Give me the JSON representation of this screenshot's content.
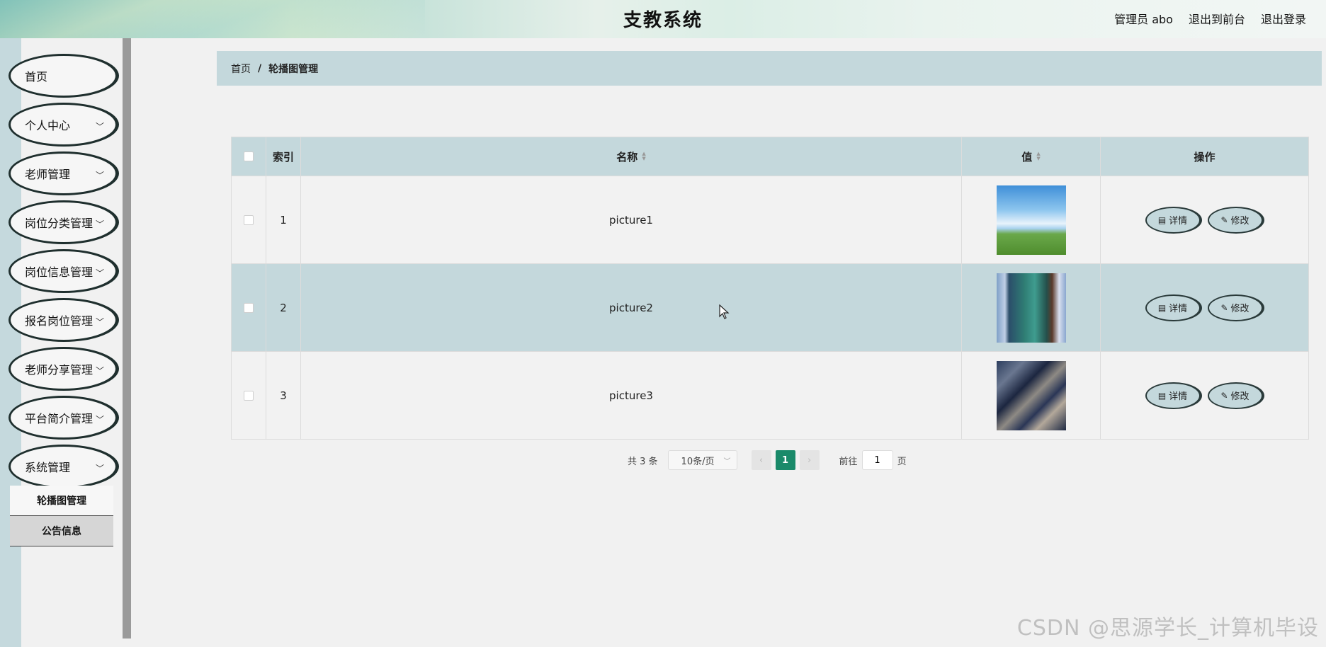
{
  "header": {
    "title": "支教系统",
    "user": "管理员 abo",
    "to_front": "退出到前台",
    "logout": "退出登录"
  },
  "sidebar": {
    "items": [
      {
        "label": "首页",
        "has_chevron": false
      },
      {
        "label": "个人中心",
        "has_chevron": true
      },
      {
        "label": "老师管理",
        "has_chevron": true
      },
      {
        "label": "岗位分类管理",
        "has_chevron": true
      },
      {
        "label": "岗位信息管理",
        "has_chevron": true
      },
      {
        "label": "报名岗位管理",
        "has_chevron": true
      },
      {
        "label": "老师分享管理",
        "has_chevron": true
      },
      {
        "label": "平台简介管理",
        "has_chevron": true
      },
      {
        "label": "系统管理",
        "has_chevron": true
      }
    ],
    "sub_items": [
      {
        "label": "轮播图管理",
        "active": true
      },
      {
        "label": "公告信息",
        "active": false
      }
    ]
  },
  "breadcrumb": {
    "home": "首页",
    "separator": "/",
    "current": "轮播图管理"
  },
  "table": {
    "headers": {
      "index": "索引",
      "name": "名称",
      "value": "值",
      "actions": "操作"
    },
    "rows": [
      {
        "index": "1",
        "name": "picture1",
        "thumb": "sky-grass-image"
      },
      {
        "index": "2",
        "name": "picture2",
        "thumb": "classroom-image"
      },
      {
        "index": "3",
        "name": "picture3",
        "thumb": "desks-image"
      }
    ],
    "detail_label": "详情",
    "edit_label": "修改"
  },
  "pagination": {
    "total": "共 3 条",
    "page_size": "10条/页",
    "current_page": "1",
    "goto_prefix": "前往",
    "goto_value": "1",
    "goto_suffix": "页"
  },
  "watermark": "CSDN @思源学长_计算机毕设",
  "colors": {
    "accent_teal": "#c4d8dc",
    "pager_active": "#1a8a6a",
    "outline_dark": "#1f2f2e"
  }
}
